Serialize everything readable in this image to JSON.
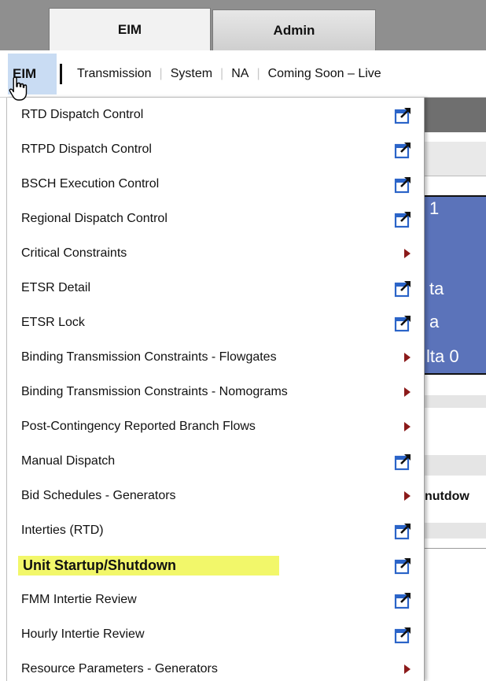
{
  "top_tabs": [
    {
      "label": "EIM"
    },
    {
      "label": "Admin"
    }
  ],
  "nav": {
    "active": "EIM",
    "items": [
      "Transmission",
      "System",
      "NA",
      "Coming Soon – Live"
    ]
  },
  "menu": {
    "items": [
      {
        "label": "RTD Dispatch Control",
        "icon": "external-link-icon"
      },
      {
        "label": "RTPD Dispatch Control",
        "icon": "external-link-icon"
      },
      {
        "label": "BSCH Execution Control",
        "icon": "external-link-icon"
      },
      {
        "label": "Regional Dispatch Control",
        "icon": "external-link-icon"
      },
      {
        "label": "Critical Constraints",
        "icon": "submenu-arrow-icon"
      },
      {
        "label": "ETSR Detail",
        "icon": "external-link-icon"
      },
      {
        "label": "ETSR Lock",
        "icon": "external-link-icon"
      },
      {
        "label": "Binding Transmission Constraints - Flowgates",
        "icon": "submenu-arrow-icon"
      },
      {
        "label": "Binding Transmission Constraints - Nomograms",
        "icon": "submenu-arrow-icon"
      },
      {
        "label": "Post-Contingency Reported Branch Flows",
        "icon": "submenu-arrow-icon"
      },
      {
        "label": "Manual Dispatch",
        "icon": "external-link-icon"
      },
      {
        "label": "Bid Schedules - Generators",
        "icon": "submenu-arrow-icon"
      },
      {
        "label": "Interties (RTD)",
        "icon": "external-link-icon"
      },
      {
        "label": "Unit Startup/Shutdown",
        "icon": "external-link-icon",
        "highlighted": true
      },
      {
        "label": "FMM Intertie Review",
        "icon": "external-link-icon"
      },
      {
        "label": "Hourly Intertie Review",
        "icon": "external-link-icon"
      },
      {
        "label": "Resource Parameters - Generators",
        "icon": "submenu-arrow-icon"
      }
    ]
  },
  "background_page": {
    "blue_panel_lines": [
      "1",
      "ta",
      "a",
      "lta 0"
    ],
    "shutdown_label": "nutdow"
  },
  "colors": {
    "highlight": "#f2f76a",
    "active_nav_bg": "#c9dcf3",
    "panel_blue": "#5b73ba",
    "submenu_arrow": "#8b1a1a",
    "link_icon_blue": "#2b64c8"
  }
}
